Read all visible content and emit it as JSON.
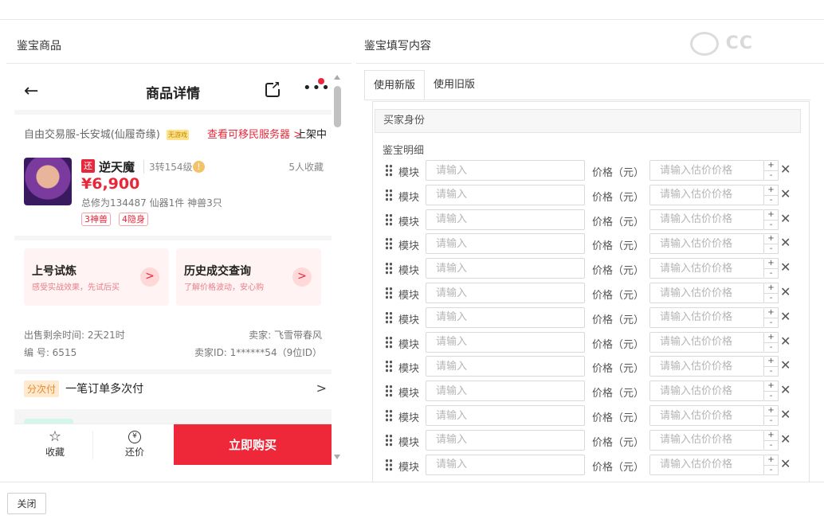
{
  "left_panel": {
    "title": "鉴宝商品"
  },
  "right_panel": {
    "title": "鉴宝填写内容"
  },
  "phone": {
    "header": {
      "title": "商品详情",
      "back_icon": "←",
      "more_icon": "•••"
    },
    "server": {
      "name": "自由交易服-长安城(仙履奇缘)",
      "tag": "无游戏",
      "link": "查看可移民服务器 >",
      "status": "上架中"
    },
    "item": {
      "badge": "还",
      "name": "逆天魔",
      "level": "3转154级",
      "warn_icon": "!",
      "favorites": "5人收藏",
      "price": "¥6,900",
      "stats": "总修为134487  仙器1件  神兽3只",
      "tags": [
        "3神兽",
        "4隐身"
      ]
    },
    "cards": [
      {
        "title": "上号试炼",
        "sub": "感受实战效果，先试后买",
        "arrow": ">"
      },
      {
        "title": "历史成交查询",
        "sub": "了解价格波动，安心购",
        "arrow": ">"
      }
    ],
    "info": {
      "time_left": "出售剩余时间: 2天21时",
      "seller": "卖家: 飞雪带春风",
      "serial": "编  号: 6515",
      "seller_id": "卖家ID: 1******54（9位ID）"
    },
    "pay": {
      "tag": "分次付",
      "text": "一笔订单多次付",
      "chevron": ">"
    },
    "bottom": {
      "fav_label": "收藏",
      "fav_icon": "☆",
      "offer_label": "还价",
      "offer_icon": "¥",
      "buy_label": "立即购买"
    }
  },
  "tabs": [
    "使用新版",
    "使用旧版"
  ],
  "form": {
    "section_title": "买家身份",
    "detail_label": "鉴宝明细",
    "module_label": "模块",
    "module_placeholder": "请输入",
    "price_label": "价格（元）",
    "price_placeholder": "请输入估价价格",
    "plus": "+",
    "minus": "-",
    "delete_icon": "✕",
    "row_count": 13
  },
  "footer": {
    "close_label": "关闭"
  },
  "watermark": "CC"
}
